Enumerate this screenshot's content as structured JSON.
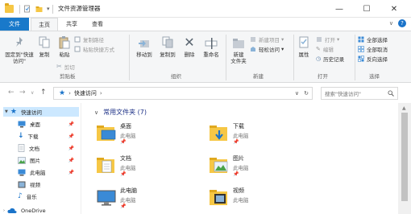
{
  "window": {
    "title": "文件资源管理器",
    "minimize": "—",
    "maximize": "☐",
    "close": "✕"
  },
  "tabs": {
    "file": "文件",
    "home": "主页",
    "share": "共享",
    "view": "查看"
  },
  "ribbon": {
    "clipboard": {
      "pin": "固定到\"快速访问\"",
      "copy": "复制",
      "paste": "粘贴",
      "copy_path": "复制路径",
      "paste_shortcut": "粘贴快捷方式",
      "cut": "剪切",
      "label": "剪贴板"
    },
    "organize": {
      "move_to": "移动到",
      "copy_to": "复制到",
      "delete": "删除",
      "rename": "重命名",
      "label": "组织"
    },
    "new": {
      "new_folder": "新建\n文件夹",
      "new_item": "新建项目",
      "easy_access": "轻松访问",
      "label": "新建"
    },
    "open": {
      "properties": "属性",
      "open": "打开",
      "edit": "编辑",
      "history": "历史记录",
      "label": "打开"
    },
    "select": {
      "select_all": "全部选择",
      "select_none": "全部取消",
      "invert": "反向选择",
      "label": "选择"
    }
  },
  "address": {
    "back": "←",
    "forward": "→",
    "recent": "∨",
    "up": "↑",
    "path": "快速访问",
    "path_arrow": "›",
    "refresh": "↻",
    "search_placeholder": "搜索\"快速访问\""
  },
  "nav": {
    "quick_access": "快速访问",
    "items": [
      {
        "label": "桌面",
        "pin": "📌"
      },
      {
        "label": "下载",
        "pin": "📌"
      },
      {
        "label": "文档",
        "pin": "📌"
      },
      {
        "label": "图片",
        "pin": "📌"
      },
      {
        "label": "此电脑",
        "pin": "📌"
      },
      {
        "label": "视频",
        "pin": ""
      },
      {
        "label": "音乐",
        "pin": ""
      }
    ],
    "onedrive": "OneDrive"
  },
  "content": {
    "section_title": "常用文件夹 (7)",
    "folders": [
      {
        "name": "桌面",
        "sub": "此电脑",
        "pin": "📌"
      },
      {
        "name": "下载",
        "sub": "此电脑",
        "pin": "📌"
      },
      {
        "name": "文档",
        "sub": "此电脑",
        "pin": "📌"
      },
      {
        "name": "图片",
        "sub": "此电脑",
        "pin": "📌"
      },
      {
        "name": "此电脑",
        "sub": "此电脑",
        "pin": "📌"
      },
      {
        "name": "视频",
        "sub": "此电脑",
        "pin": ""
      }
    ]
  }
}
